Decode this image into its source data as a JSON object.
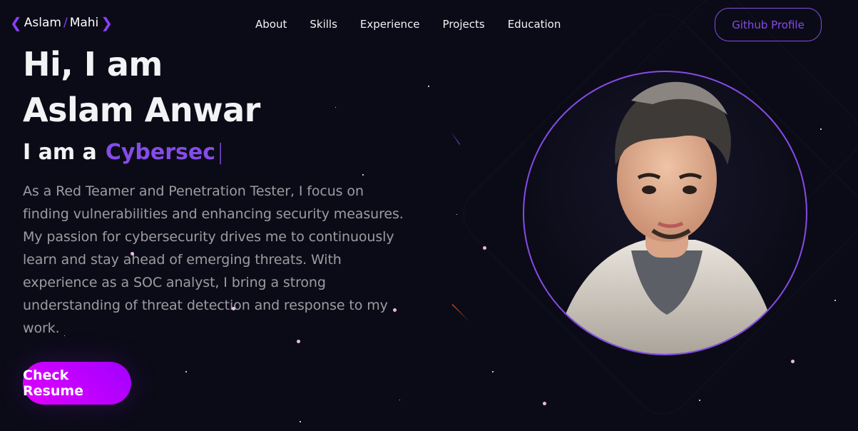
{
  "header": {
    "logo": {
      "left": "Aslam",
      "slash": "/",
      "right": "Mahi"
    },
    "nav": [
      "About",
      "Skills",
      "Experience",
      "Projects",
      "Education"
    ],
    "github_label": "Github Profile"
  },
  "hero": {
    "title_line1": "Hi, I am",
    "title_line2": "Aslam Anwar",
    "typed_prefix": "I am a",
    "typed_role": "Cybersec",
    "typed_cursor": "|",
    "description": "As a Red Teamer and Penetration Tester, I focus on finding vulnerabilities and enhancing security measures. My passion for cybersecurity drives me to continuously learn and stay ahead of emerging threats. With experience as a SOC analyst, I bring a strong understanding of threat detection and response to my work.",
    "resume_label": "Check Resume"
  },
  "colors": {
    "background": "#0b0b17",
    "accent": "#854ce6",
    "button_gradient_start": "#a100ff",
    "button_gradient_end": "#e100ff"
  },
  "icons": [
    "chevron-left-icon",
    "chevron-right-icon"
  ]
}
